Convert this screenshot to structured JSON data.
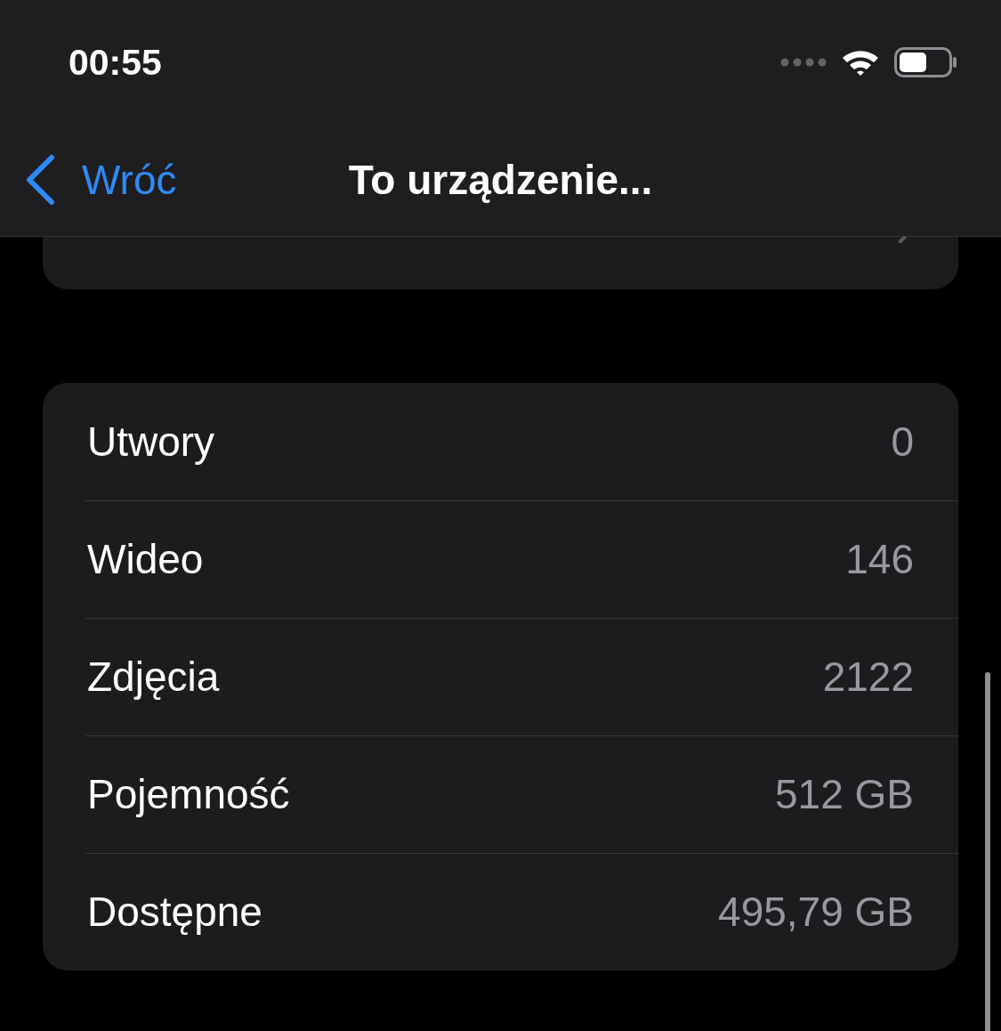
{
  "status_bar": {
    "time": "00:55"
  },
  "nav": {
    "back": "Wróć",
    "title": "To urządzenie..."
  },
  "sections": [
    {
      "rows": [
        {
          "kind": "link"
        }
      ]
    },
    {
      "rows": [
        {
          "kind": "value",
          "label": "Utwory",
          "value": "0"
        },
        {
          "kind": "value",
          "label": "Wideo",
          "value": "146"
        },
        {
          "kind": "value",
          "label": "Zdjęcia",
          "value": "2122"
        },
        {
          "kind": "value",
          "label": "Pojemność",
          "value": "512 GB"
        },
        {
          "kind": "value",
          "label": "Dostępne",
          "value": "495,79 GB"
        }
      ]
    }
  ]
}
